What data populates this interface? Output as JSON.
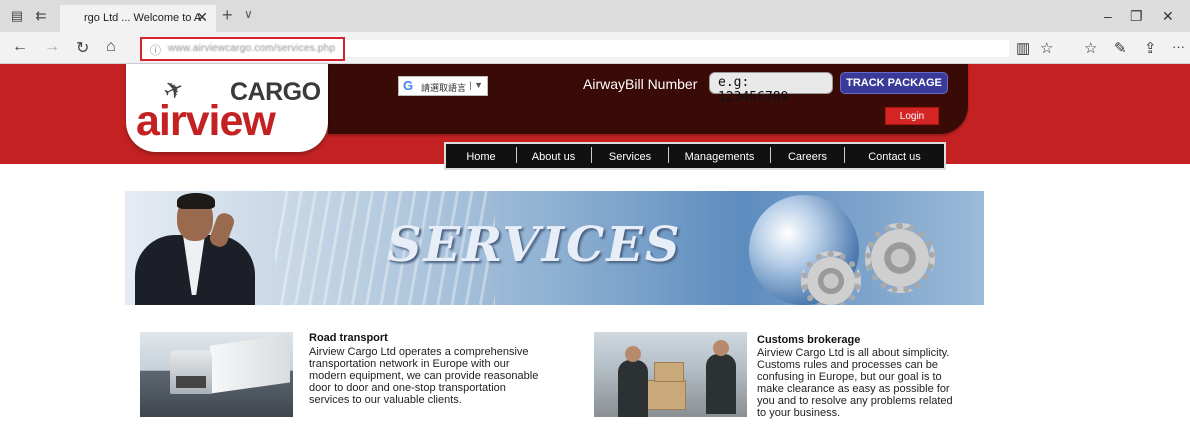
{
  "browser": {
    "tab_title": "rgo Ltd ... Welcome to A",
    "tab_close": "✕",
    "new_tab": "+",
    "tab_menu": "∨",
    "url": "www.airviewcargo.com/services.php",
    "window_controls": {
      "minimize": "–",
      "restore": "❐",
      "close": "✕"
    },
    "nav": {
      "back": "←",
      "forward": "→",
      "refresh": "↻",
      "home": "⌂"
    },
    "toolbar_icons": {
      "reading_view": "📖",
      "favorite": "☆",
      "favorites_bar": "☆≡",
      "notes": "✎",
      "share": "⇪",
      "more": "···"
    }
  },
  "header": {
    "logo_cargo": "CARGO",
    "logo_airview": "airview",
    "translate_label": "請選取語言",
    "translate_google": "G",
    "airwaybill_label": "AirwayBill Number",
    "airwaybill_placeholder": "e.g: 123456789",
    "track_button": "TRACK PACKAGE",
    "login_button": "Login"
  },
  "nav": {
    "items": [
      {
        "label": "Home"
      },
      {
        "label": "About us"
      },
      {
        "label": "Services"
      },
      {
        "label": "Managements"
      },
      {
        "label": "Careers"
      },
      {
        "label": "Contact us"
      }
    ]
  },
  "banner": {
    "title": "SERVICES"
  },
  "services": [
    {
      "title": "Road transport",
      "lines": [
        "Airview Cargo Ltd operates a comprehensive",
        "transportation network in Europe with our",
        "modern equipment, we can provide reasonable",
        "door to door and one-stop transportation",
        "services to our valuable clients."
      ]
    },
    {
      "title": "Customs brokerage",
      "lines": [
        "Airview Cargo Ltd is all about simplicity.",
        "Customs rules and processes can be",
        "confusing in Europe, but our goal is to",
        "make clearance as easy as possible for",
        "you and to resolve any problems related",
        "to your business."
      ]
    }
  ],
  "colors": {
    "header_red": "#c42222",
    "header_dark": "#3a0a06",
    "track_blue": "#3a3a9a",
    "nav_black": "#111111"
  }
}
